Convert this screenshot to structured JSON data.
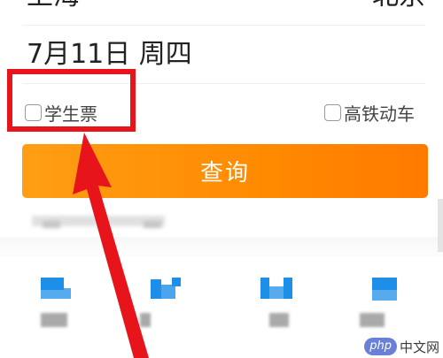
{
  "route": {
    "from_city": "上海",
    "to_city": "北京"
  },
  "date": {
    "text": "7月11日 周四"
  },
  "options": {
    "student_ticket_label": "学生票",
    "high_speed_label": "高铁动车"
  },
  "actions": {
    "query_label": "查询"
  },
  "colors": {
    "accent_orange": "#ff8a00",
    "annotation_red": "#e8141b",
    "icon_blue": "#1e8fe8"
  },
  "icons": {
    "swap": "swap-icon",
    "shortcuts": [
      "shortcut-icon-1",
      "shortcut-icon-2",
      "shortcut-icon-3",
      "shortcut-icon-4"
    ]
  },
  "watermark": {
    "badge": "php",
    "text": "中文网"
  }
}
